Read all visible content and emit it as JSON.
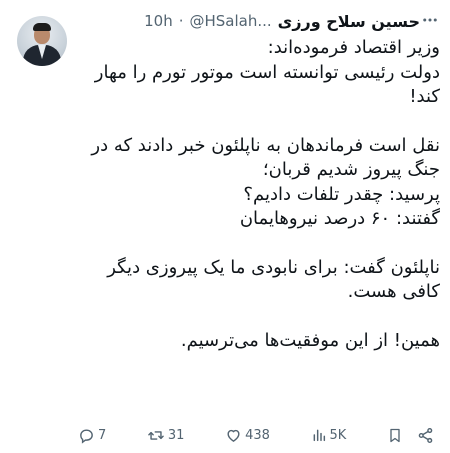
{
  "tweet": {
    "author_name": "حسین سلاح ورزی",
    "handle": "@HSalah...",
    "separator": "·",
    "time": "10h",
    "paragraphs": [
      "وزیر اقتصاد فرموده‌اند:\nدولت رئیسی توانسته است موتور تورم را مهار کند!",
      "نقل است فرماندهان  به ناپلئون خبر دادند که در جنگ پیروز شدیم قربان؛\nپرسید: چقدر تلفات دادیم؟\nگفتند: ۶۰ درصد نیروهایمان",
      "ناپلئون گفت: برای نابودی ما یک پیروزی دیگر کافی هست.",
      "همین! از این موفقیت‌ها می‌ترسیم."
    ]
  },
  "actions": {
    "replies": "7",
    "retweets": "31",
    "likes": "438",
    "views": "5K"
  },
  "icons": {
    "more": "more-dots-icon",
    "reply": "reply-icon",
    "retweet": "retweet-icon",
    "like": "heart-icon",
    "views": "views-chart-icon",
    "bookmark": "bookmark-icon",
    "share": "share-icon"
  },
  "colors": {
    "text": "#0f1419",
    "secondary": "#536471",
    "background": "#ffffff"
  }
}
